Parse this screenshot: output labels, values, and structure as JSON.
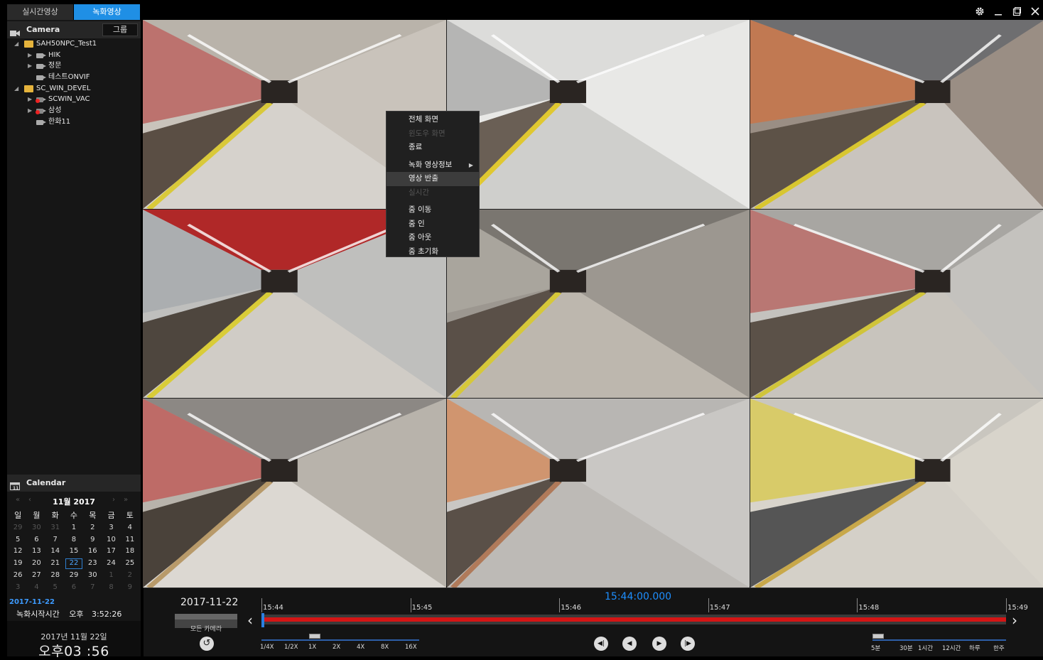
{
  "mode_tabs": [
    {
      "label": "실시간영상"
    },
    {
      "label": "녹화영상"
    }
  ],
  "camera_section": {
    "title": "Camera",
    "group_button": "그룹"
  },
  "tree": [
    {
      "label": "SAH50NPC_Test1",
      "type": "folder",
      "expanded": true,
      "indent": 0
    },
    {
      "label": "HIK",
      "type": "camera",
      "indent": 1,
      "expandable": true
    },
    {
      "label": "정문",
      "type": "camera",
      "indent": 1,
      "expandable": true
    },
    {
      "label": "테스트ONVIF",
      "type": "camera",
      "indent": 1,
      "expandable": false
    },
    {
      "label": "SC_WIN_DEVEL",
      "type": "folder",
      "expanded": true,
      "indent": 0
    },
    {
      "label": "SCWIN_VAC",
      "type": "camera-error",
      "indent": 1,
      "expandable": true
    },
    {
      "label": "삼성",
      "type": "camera-error",
      "indent": 1,
      "expandable": true
    },
    {
      "label": "한화11",
      "type": "camera",
      "indent": 1,
      "expandable": false
    }
  ],
  "calendar": {
    "title": "Calendar",
    "month_label": "11월 2017",
    "weekdays": [
      "일",
      "월",
      "화",
      "수",
      "목",
      "금",
      "토"
    ],
    "weeks": [
      [
        {
          "d": "29",
          "dim": true
        },
        {
          "d": "30",
          "dim": true
        },
        {
          "d": "31",
          "dim": true
        },
        {
          "d": "1"
        },
        {
          "d": "2"
        },
        {
          "d": "3"
        },
        {
          "d": "4"
        }
      ],
      [
        {
          "d": "5"
        },
        {
          "d": "6"
        },
        {
          "d": "7"
        },
        {
          "d": "8"
        },
        {
          "d": "9"
        },
        {
          "d": "10"
        },
        {
          "d": "11"
        }
      ],
      [
        {
          "d": "12"
        },
        {
          "d": "13"
        },
        {
          "d": "14"
        },
        {
          "d": "15"
        },
        {
          "d": "16"
        },
        {
          "d": "17"
        },
        {
          "d": "18"
        }
      ],
      [
        {
          "d": "19"
        },
        {
          "d": "20"
        },
        {
          "d": "21"
        },
        {
          "d": "22",
          "selected": true
        },
        {
          "d": "23"
        },
        {
          "d": "24"
        },
        {
          "d": "25"
        }
      ],
      [
        {
          "d": "26"
        },
        {
          "d": "27"
        },
        {
          "d": "28"
        },
        {
          "d": "29"
        },
        {
          "d": "30"
        },
        {
          "d": "1",
          "dim": true
        },
        {
          "d": "2",
          "dim": true
        }
      ],
      [
        {
          "d": "3",
          "dim": true
        },
        {
          "d": "4",
          "dim": true
        },
        {
          "d": "5",
          "dim": true
        },
        {
          "d": "6",
          "dim": true
        },
        {
          "d": "7",
          "dim": true
        },
        {
          "d": "8",
          "dim": true
        },
        {
          "d": "9",
          "dim": true
        }
      ]
    ],
    "selected_date": "2017-11-22",
    "record_start_label": "녹화시작시간",
    "record_start_ampm": "오후",
    "record_start_time": "3:52:26"
  },
  "clock": {
    "date": "2017년 11월 22일",
    "time": "오후03 :56"
  },
  "context_menu": [
    {
      "label": "전체 화면",
      "disabled": false
    },
    {
      "label": "윈도우 화면",
      "disabled": true
    },
    {
      "label": "종료",
      "disabled": false
    },
    {
      "sep": true
    },
    {
      "label": "녹화 영상정보",
      "disabled": false,
      "submenu": true
    },
    {
      "label": "영상 반출",
      "disabled": false,
      "highlight": true
    },
    {
      "label": "실시간",
      "disabled": true
    },
    {
      "sep": true
    },
    {
      "label": "줌 이동",
      "disabled": false
    },
    {
      "label": "줌 인",
      "disabled": false
    },
    {
      "label": "줌 아웃",
      "disabled": false
    },
    {
      "label": "줌 초기화",
      "disabled": false
    }
  ],
  "playback": {
    "date": "2017-11-22",
    "all_cameras_label": "모든 카메라",
    "current_time": "15:44:00.000",
    "time_labels": [
      "15:44",
      "15:45",
      "15:46",
      "15:47",
      "15:48",
      "15:49"
    ],
    "speed_labels": [
      "1/4X",
      "1/2X",
      "1X",
      "2X",
      "4X",
      "8X",
      "16X"
    ],
    "range_labels": [
      "5분",
      "30분",
      "1시간",
      "12시간",
      "하루",
      "한주"
    ],
    "progress": 0.0
  },
  "tiles": [
    {
      "theme": "warm"
    },
    {
      "theme": "white"
    },
    {
      "theme": "orange"
    },
    {
      "theme": "train"
    },
    {
      "theme": "pillars"
    },
    {
      "theme": "bench"
    },
    {
      "theme": "tunnel"
    },
    {
      "theme": "silver"
    },
    {
      "theme": "yellow"
    }
  ],
  "colors": {
    "accent": "#1f8fe5",
    "selected_tile": "#d6c22e",
    "timeline": "#d41515"
  }
}
